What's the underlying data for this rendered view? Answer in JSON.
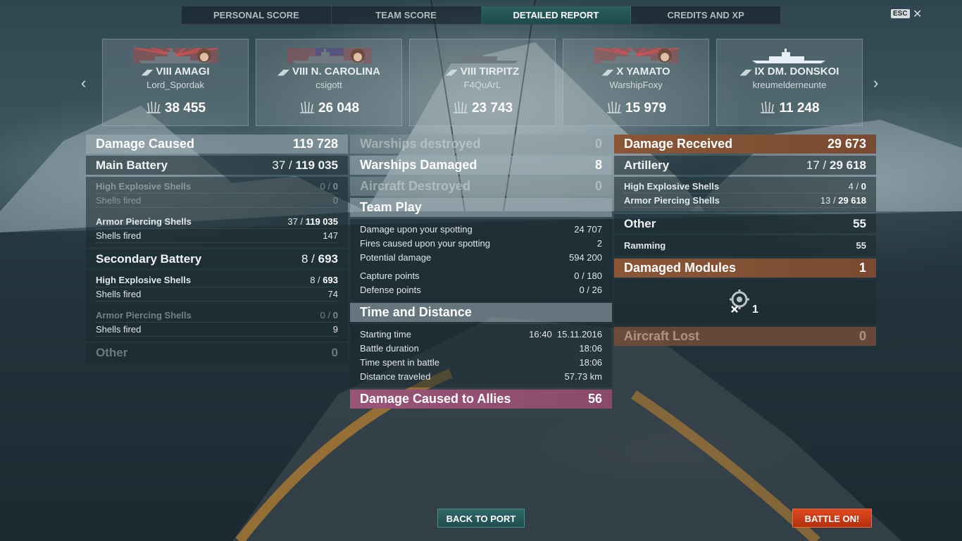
{
  "tabs": [
    "PERSONAL SCORE",
    "TEAM SCORE",
    "DETAILED REPORT",
    "CREDITS AND XP"
  ],
  "active_tab": "DETAILED REPORT",
  "esc_label": "ESC",
  "close_label": "✕",
  "nav": {
    "prev": "‹",
    "next": "›"
  },
  "players": [
    {
      "tier": "VIII",
      "ship": "AMAGI",
      "name": "Lord_Spordak",
      "score": "38 455",
      "flag": "jp"
    },
    {
      "tier": "VIII",
      "ship": "N. CAROLINA",
      "name": "csigott",
      "score": "26 048",
      "flag": "us"
    },
    {
      "tier": "VIII",
      "ship": "TIRPITZ",
      "name": "F4QuArL",
      "score": "23 743",
      "flag": "none"
    },
    {
      "tier": "X",
      "ship": "YAMATO",
      "name": "WarshipFoxy",
      "score": "15 979",
      "flag": "jp"
    },
    {
      "tier": "IX",
      "ship": "DM. DONSKOI",
      "name": "kreumelderneunte",
      "score": "11 248",
      "flag": "none"
    }
  ],
  "left": {
    "damage_caused": {
      "label": "Damage Caused",
      "value": "119 728"
    },
    "main_battery": {
      "label": "Main Battery",
      "hits": "37 /",
      "dmg": "119 035"
    },
    "mb_he": {
      "label": "High Explosive Shells",
      "hits": "0 /",
      "dmg": "0"
    },
    "mb_he_fired": {
      "label": "Shells fired",
      "value": "0"
    },
    "mb_ap": {
      "label": "Armor Piercing Shells",
      "hits": "37 /",
      "dmg": "119 035"
    },
    "mb_ap_fired": {
      "label": "Shells fired",
      "value": "147"
    },
    "secondary": {
      "label": "Secondary Battery",
      "hits": "8 /",
      "dmg": "693"
    },
    "sb_he": {
      "label": "High Explosive Shells",
      "hits": "8 /",
      "dmg": "693"
    },
    "sb_he_fired": {
      "label": "Shells fired",
      "value": "74"
    },
    "sb_ap": {
      "label": "Armor Piercing Shells",
      "hits": "0 /",
      "dmg": "0"
    },
    "sb_ap_fired": {
      "label": "Shells fired",
      "value": "9"
    },
    "other": {
      "label": "Other",
      "value": "0"
    }
  },
  "middle": {
    "warships_destroyed": {
      "label": "Warships destroyed",
      "value": "0"
    },
    "warships_damaged": {
      "label": "Warships Damaged",
      "value": "8"
    },
    "aircraft_destroyed": {
      "label": "Aircraft Destroyed",
      "value": "0"
    },
    "team_play": "Team Play",
    "spotting_damage": {
      "label": "Damage upon your spotting",
      "value": "24 707"
    },
    "spotting_fires": {
      "label": "Fires caused upon your spotting",
      "value": "2"
    },
    "potential_damage": {
      "label": "Potential damage",
      "value": "594 200"
    },
    "capture_points": {
      "label": "Capture points",
      "value": "0 / 180"
    },
    "defense_points": {
      "label": "Defense points",
      "value": "0 / 26"
    },
    "time_distance": "Time and Distance",
    "starting_time": {
      "label": "Starting time",
      "value": "16:40  15.11.2016"
    },
    "battle_duration": {
      "label": "Battle duration",
      "value": "18:06"
    },
    "time_in_battle": {
      "label": "Time spent in battle",
      "value": "18:06"
    },
    "distance": {
      "label": "Distance traveled",
      "value": "57.73 km"
    },
    "allied_damage": {
      "label": "Damage Caused to Allies",
      "value": "56"
    }
  },
  "right": {
    "damage_received": {
      "label": "Damage Received",
      "value": "29 673"
    },
    "artillery": {
      "label": "Artillery",
      "hits": "17 /",
      "dmg": "29 618"
    },
    "art_he": {
      "label": "High Explosive Shells",
      "hits": "4 /",
      "dmg": "0"
    },
    "art_ap": {
      "label": "Armor Piercing Shells",
      "hits": "13 /",
      "dmg": "29 618"
    },
    "other": {
      "label": "Other",
      "value": "55"
    },
    "ramming": {
      "label": "Ramming",
      "value": "55"
    },
    "damaged_modules": {
      "label": "Damaged Modules",
      "value": "1"
    },
    "module_count": "1",
    "aircraft_lost": {
      "label": "Aircraft Lost",
      "value": "0"
    }
  },
  "buttons": {
    "back": "BACK TO PORT",
    "battle": "BATTLE ON!"
  },
  "colors": {
    "accent_teal": "#2b5f60",
    "orange_header": "#8a5637",
    "pink_header": "#9a5478",
    "battle_button": "#d9441b"
  }
}
